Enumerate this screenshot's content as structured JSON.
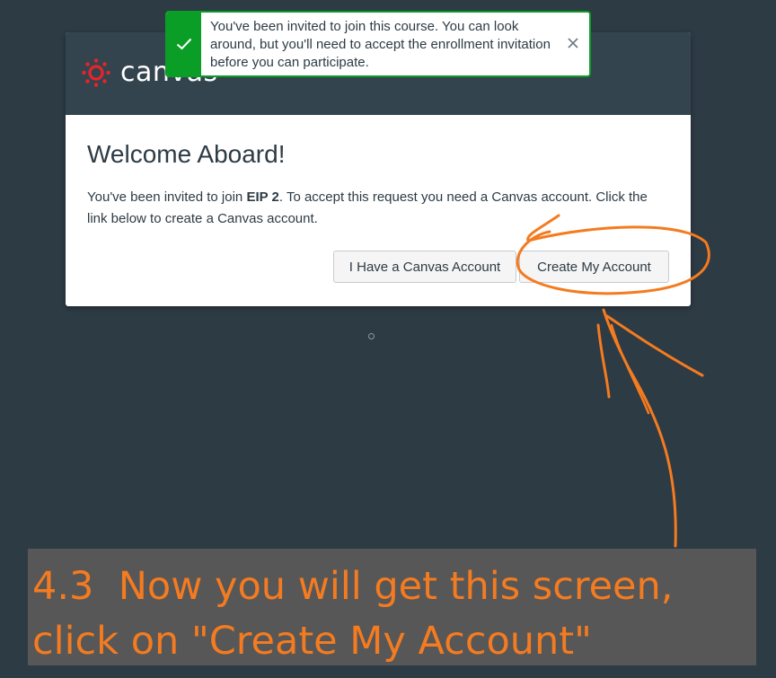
{
  "app": {
    "name": "canvas",
    "brand_color": "#e72429",
    "header_color": "#34444f",
    "background_color": "#2d3b45"
  },
  "toast": {
    "message": "You've been invited to join this course. You can look around, but you'll need to accept the enrollment invitation before you can participate.",
    "icon": "checkmark-icon",
    "close_icon": "close-icon",
    "accent_color": "#0b9e27"
  },
  "modal": {
    "title": "Welcome Aboard!",
    "description_before": "You've been invited to join ",
    "course_name": "EIP 2",
    "description_after": ". To accept this request you need a Canvas account. Click the link below to create a Canvas account.",
    "buttons": {
      "have_account": "I Have a Canvas Account",
      "create_account": "Create My Account"
    }
  },
  "annotation": {
    "text": "4.3  Now you will get this screen, click on \"Create My Account\"",
    "text_color": "#f47b20",
    "mark_color": "#f47b20"
  }
}
